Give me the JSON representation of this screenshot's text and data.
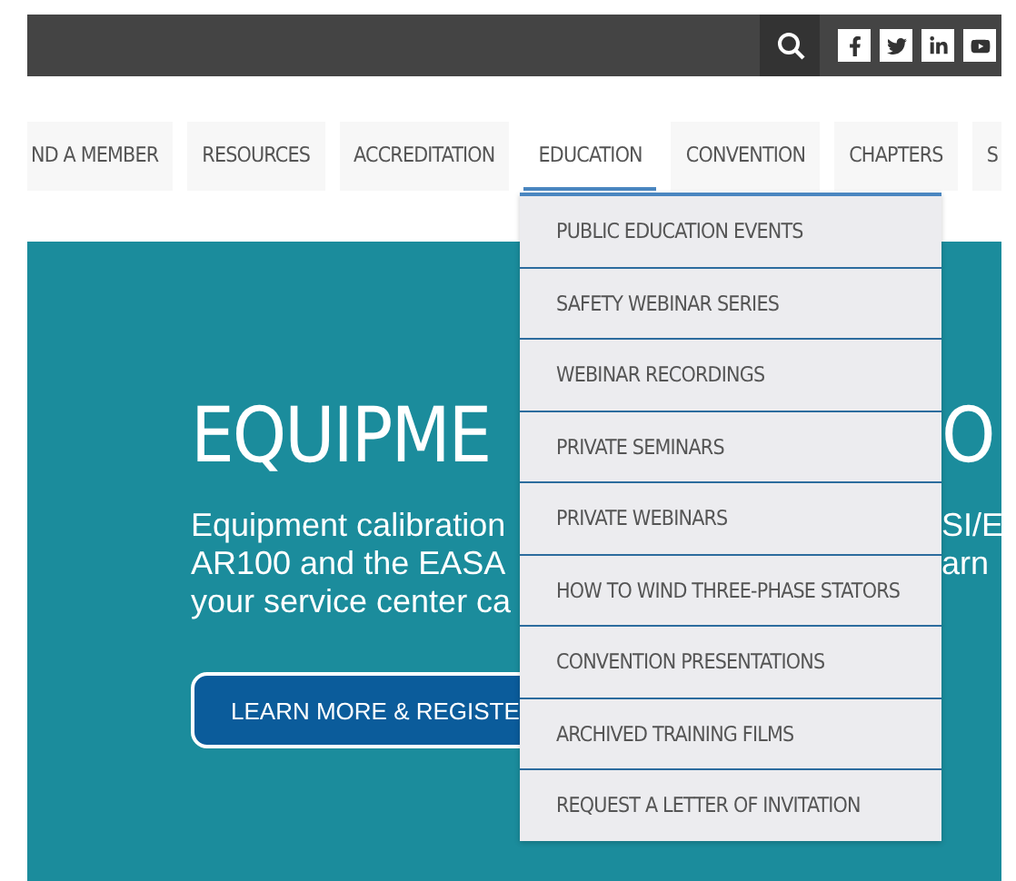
{
  "top_bar": {
    "social_links": [
      {
        "kind": "facebook"
      },
      {
        "kind": "twitter"
      },
      {
        "kind": "linkedin"
      },
      {
        "kind": "youtube"
      }
    ]
  },
  "nav": [
    {
      "label": "ND A MEMBER",
      "selected": false
    },
    {
      "label": "RESOURCES",
      "selected": false
    },
    {
      "label": "ACCREDITATION",
      "selected": false
    },
    {
      "label": "EDUCATION",
      "selected": true
    },
    {
      "label": "CONVENTION",
      "selected": false
    },
    {
      "label": "CHAPTERS",
      "selected": false
    },
    {
      "label": "S",
      "selected": false
    }
  ],
  "dropdown": [
    "PUBLIC EDUCATION EVENTS",
    "SAFETY WEBINAR SERIES",
    "WEBINAR RECORDINGS",
    "PRIVATE SEMINARS",
    "PRIVATE WEBINARS",
    "HOW TO WIND THREE-PHASE STATORS",
    "CONVENTION PRESENTATIONS",
    "ARCHIVED TRAINING FILMS",
    "REQUEST A LETTER OF INVITATION"
  ],
  "hero": {
    "title": [
      "EQUIPME",
      "O"
    ],
    "lines": [
      [
        "Equipment calibration",
        "SI/E"
      ],
      [
        "AR100 and the EASA",
        "arn"
      ],
      [
        "your service center ca"
      ]
    ],
    "button": "LEARN MORE & REGISTE"
  }
}
